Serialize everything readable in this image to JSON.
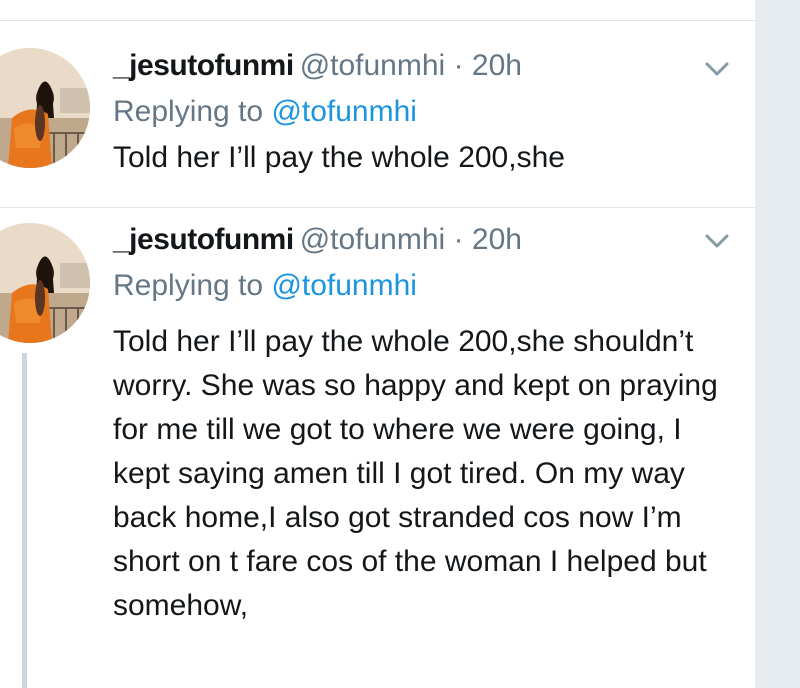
{
  "tweets": [
    {
      "name": "_jesutofunmi",
      "handle": "@tofunmhi",
      "separator": "·",
      "time": "20h",
      "replying_prefix": "Replying to",
      "replying_handle": "@tofunmhi",
      "text": "Told her I’ll pay the whole 200,she"
    },
    {
      "name": "_jesutofunmi",
      "handle": "@tofunmhi",
      "separator": "·",
      "time": "20h",
      "replying_prefix": "Replying to",
      "replying_handle": "@tofunmhi",
      "text": "Told her I’ll pay the whole 200,she shouldn’t worry. She was so happy and kept on praying for me till we got to where we were going, I kept saying amen till I got tired. On my way back home,I also got stranded cos now I’m short on t fare cos of the woman I helped but somehow,"
    }
  ],
  "icons": {
    "more": "chevron-down-icon",
    "avatar": "profile-photo"
  },
  "colors": {
    "text": "#14171a",
    "secondary": "#657786",
    "link": "#1b95e0",
    "divider": "#e1e8ed",
    "thread_line": "#ccd6dd",
    "scrollbar": "#e6ecf0"
  }
}
